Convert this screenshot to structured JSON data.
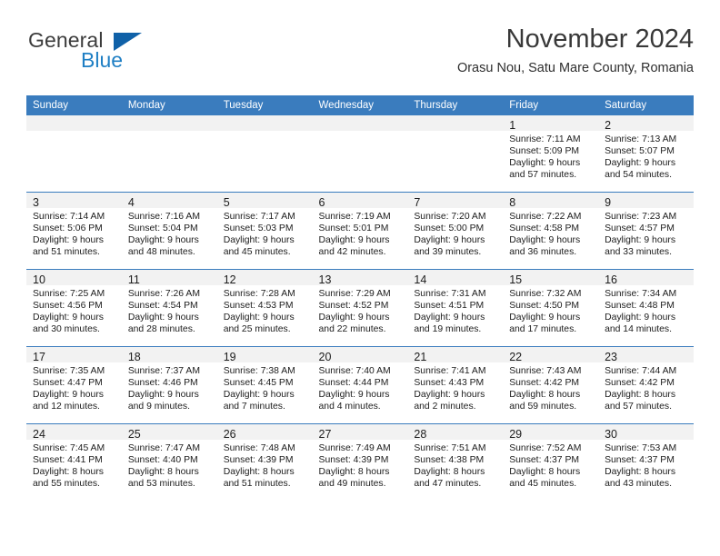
{
  "brand": {
    "name_part1": "General",
    "name_part2": "Blue",
    "logo_icon": "triangle-logo-icon"
  },
  "header": {
    "month_year": "November 2024",
    "location": "Orasu Nou, Satu Mare County, Romania"
  },
  "colors": {
    "header_blue": "#3a7cbe",
    "brand_blue": "#1f7fc4",
    "logo_blue": "#1061a8",
    "daynum_band": "#f2f2f2"
  },
  "weekday_headers": [
    "Sunday",
    "Monday",
    "Tuesday",
    "Wednesday",
    "Thursday",
    "Friday",
    "Saturday"
  ],
  "weeks": [
    [
      {
        "day": "",
        "empty": true
      },
      {
        "day": "",
        "empty": true
      },
      {
        "day": "",
        "empty": true
      },
      {
        "day": "",
        "empty": true
      },
      {
        "day": "",
        "empty": true
      },
      {
        "day": "1",
        "sunrise": "Sunrise: 7:11 AM",
        "sunset": "Sunset: 5:09 PM",
        "daylight_line1": "Daylight: 9 hours",
        "daylight_line2": "and 57 minutes."
      },
      {
        "day": "2",
        "sunrise": "Sunrise: 7:13 AM",
        "sunset": "Sunset: 5:07 PM",
        "daylight_line1": "Daylight: 9 hours",
        "daylight_line2": "and 54 minutes."
      }
    ],
    [
      {
        "day": "3",
        "sunrise": "Sunrise: 7:14 AM",
        "sunset": "Sunset: 5:06 PM",
        "daylight_line1": "Daylight: 9 hours",
        "daylight_line2": "and 51 minutes."
      },
      {
        "day": "4",
        "sunrise": "Sunrise: 7:16 AM",
        "sunset": "Sunset: 5:04 PM",
        "daylight_line1": "Daylight: 9 hours",
        "daylight_line2": "and 48 minutes."
      },
      {
        "day": "5",
        "sunrise": "Sunrise: 7:17 AM",
        "sunset": "Sunset: 5:03 PM",
        "daylight_line1": "Daylight: 9 hours",
        "daylight_line2": "and 45 minutes."
      },
      {
        "day": "6",
        "sunrise": "Sunrise: 7:19 AM",
        "sunset": "Sunset: 5:01 PM",
        "daylight_line1": "Daylight: 9 hours",
        "daylight_line2": "and 42 minutes."
      },
      {
        "day": "7",
        "sunrise": "Sunrise: 7:20 AM",
        "sunset": "Sunset: 5:00 PM",
        "daylight_line1": "Daylight: 9 hours",
        "daylight_line2": "and 39 minutes."
      },
      {
        "day": "8",
        "sunrise": "Sunrise: 7:22 AM",
        "sunset": "Sunset: 4:58 PM",
        "daylight_line1": "Daylight: 9 hours",
        "daylight_line2": "and 36 minutes."
      },
      {
        "day": "9",
        "sunrise": "Sunrise: 7:23 AM",
        "sunset": "Sunset: 4:57 PM",
        "daylight_line1": "Daylight: 9 hours",
        "daylight_line2": "and 33 minutes."
      }
    ],
    [
      {
        "day": "10",
        "sunrise": "Sunrise: 7:25 AM",
        "sunset": "Sunset: 4:56 PM",
        "daylight_line1": "Daylight: 9 hours",
        "daylight_line2": "and 30 minutes."
      },
      {
        "day": "11",
        "sunrise": "Sunrise: 7:26 AM",
        "sunset": "Sunset: 4:54 PM",
        "daylight_line1": "Daylight: 9 hours",
        "daylight_line2": "and 28 minutes."
      },
      {
        "day": "12",
        "sunrise": "Sunrise: 7:28 AM",
        "sunset": "Sunset: 4:53 PM",
        "daylight_line1": "Daylight: 9 hours",
        "daylight_line2": "and 25 minutes."
      },
      {
        "day": "13",
        "sunrise": "Sunrise: 7:29 AM",
        "sunset": "Sunset: 4:52 PM",
        "daylight_line1": "Daylight: 9 hours",
        "daylight_line2": "and 22 minutes."
      },
      {
        "day": "14",
        "sunrise": "Sunrise: 7:31 AM",
        "sunset": "Sunset: 4:51 PM",
        "daylight_line1": "Daylight: 9 hours",
        "daylight_line2": "and 19 minutes."
      },
      {
        "day": "15",
        "sunrise": "Sunrise: 7:32 AM",
        "sunset": "Sunset: 4:50 PM",
        "daylight_line1": "Daylight: 9 hours",
        "daylight_line2": "and 17 minutes."
      },
      {
        "day": "16",
        "sunrise": "Sunrise: 7:34 AM",
        "sunset": "Sunset: 4:48 PM",
        "daylight_line1": "Daylight: 9 hours",
        "daylight_line2": "and 14 minutes."
      }
    ],
    [
      {
        "day": "17",
        "sunrise": "Sunrise: 7:35 AM",
        "sunset": "Sunset: 4:47 PM",
        "daylight_line1": "Daylight: 9 hours",
        "daylight_line2": "and 12 minutes."
      },
      {
        "day": "18",
        "sunrise": "Sunrise: 7:37 AM",
        "sunset": "Sunset: 4:46 PM",
        "daylight_line1": "Daylight: 9 hours",
        "daylight_line2": "and 9 minutes."
      },
      {
        "day": "19",
        "sunrise": "Sunrise: 7:38 AM",
        "sunset": "Sunset: 4:45 PM",
        "daylight_line1": "Daylight: 9 hours",
        "daylight_line2": "and 7 minutes."
      },
      {
        "day": "20",
        "sunrise": "Sunrise: 7:40 AM",
        "sunset": "Sunset: 4:44 PM",
        "daylight_line1": "Daylight: 9 hours",
        "daylight_line2": "and 4 minutes."
      },
      {
        "day": "21",
        "sunrise": "Sunrise: 7:41 AM",
        "sunset": "Sunset: 4:43 PM",
        "daylight_line1": "Daylight: 9 hours",
        "daylight_line2": "and 2 minutes."
      },
      {
        "day": "22",
        "sunrise": "Sunrise: 7:43 AM",
        "sunset": "Sunset: 4:42 PM",
        "daylight_line1": "Daylight: 8 hours",
        "daylight_line2": "and 59 minutes."
      },
      {
        "day": "23",
        "sunrise": "Sunrise: 7:44 AM",
        "sunset": "Sunset: 4:42 PM",
        "daylight_line1": "Daylight: 8 hours",
        "daylight_line2": "and 57 minutes."
      }
    ],
    [
      {
        "day": "24",
        "sunrise": "Sunrise: 7:45 AM",
        "sunset": "Sunset: 4:41 PM",
        "daylight_line1": "Daylight: 8 hours",
        "daylight_line2": "and 55 minutes."
      },
      {
        "day": "25",
        "sunrise": "Sunrise: 7:47 AM",
        "sunset": "Sunset: 4:40 PM",
        "daylight_line1": "Daylight: 8 hours",
        "daylight_line2": "and 53 minutes."
      },
      {
        "day": "26",
        "sunrise": "Sunrise: 7:48 AM",
        "sunset": "Sunset: 4:39 PM",
        "daylight_line1": "Daylight: 8 hours",
        "daylight_line2": "and 51 minutes."
      },
      {
        "day": "27",
        "sunrise": "Sunrise: 7:49 AM",
        "sunset": "Sunset: 4:39 PM",
        "daylight_line1": "Daylight: 8 hours",
        "daylight_line2": "and 49 minutes."
      },
      {
        "day": "28",
        "sunrise": "Sunrise: 7:51 AM",
        "sunset": "Sunset: 4:38 PM",
        "daylight_line1": "Daylight: 8 hours",
        "daylight_line2": "and 47 minutes."
      },
      {
        "day": "29",
        "sunrise": "Sunrise: 7:52 AM",
        "sunset": "Sunset: 4:37 PM",
        "daylight_line1": "Daylight: 8 hours",
        "daylight_line2": "and 45 minutes."
      },
      {
        "day": "30",
        "sunrise": "Sunrise: 7:53 AM",
        "sunset": "Sunset: 4:37 PM",
        "daylight_line1": "Daylight: 8 hours",
        "daylight_line2": "and 43 minutes."
      }
    ]
  ]
}
